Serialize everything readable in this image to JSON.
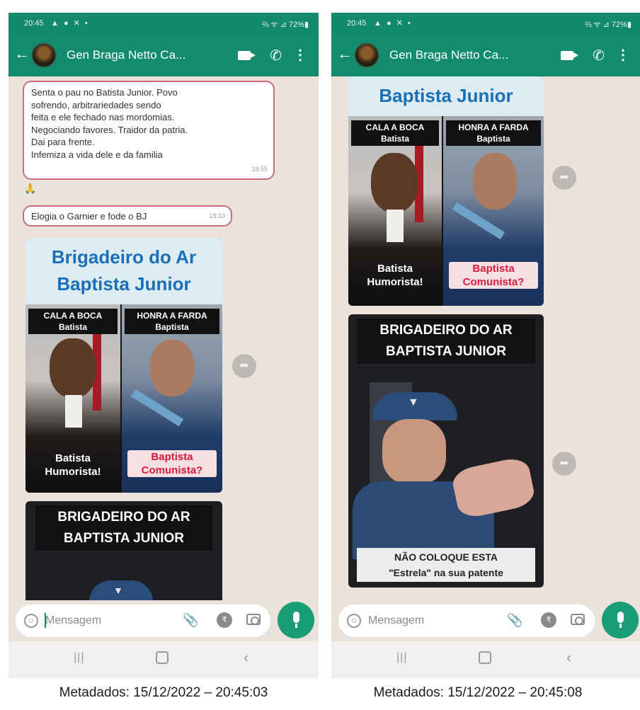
{
  "left": {
    "status": {
      "time": "20:45",
      "notif": "▲ ● ✕ •",
      "sys": "⅔ ᯤ ⊿ 72%▮"
    },
    "contact_name": "Gen Braga Netto Ca...",
    "message1": {
      "lines": [
        "Senta o pau no Batista Junior. Povo",
        "sofrendo, arbitrariedades sendo",
        "feita e ele fechado nas mordomias.",
        "Negociando favores. Traidor da patria.",
        "Dai para frente.",
        "Infemiza a vida dele e da familia"
      ],
      "time": "18:55"
    },
    "reaction": "🙏",
    "message2": {
      "text": "Elogia o Garnier e fode o BJ",
      "time": "19:10"
    },
    "meme1": {
      "header": [
        "Brigadeiro do Ar",
        "Baptista Junior"
      ],
      "tag_left": [
        "CALA A BOCA",
        "Batista"
      ],
      "tag_right": [
        "HONRA A FARDA",
        "Baptista"
      ],
      "caption_left": [
        "Batista",
        "Humorista!"
      ],
      "caption_right": [
        "Baptista",
        "Comunista?"
      ]
    },
    "meme2": {
      "title": [
        "BRIGADEIRO DO AR",
        "BAPTISTA JUNIOR"
      ]
    },
    "composer_placeholder": "Mensagem",
    "metadata": "Metadados: 15/12/2022 – 20:45:03"
  },
  "right": {
    "status": {
      "time": "20:45",
      "notif": "▲ ● ✕ •",
      "sys": "⅔ ᯤ ⊿ 72%▮"
    },
    "contact_name": "Gen Braga Netto Ca...",
    "meme1": {
      "header": [
        "Baptista Junior"
      ],
      "tag_left": [
        "CALA A BOCA",
        "Batista"
      ],
      "tag_right": [
        "HONRA A FARDA",
        "Baptista"
      ],
      "caption_left": [
        "Batista",
        "Humorista!"
      ],
      "caption_right": [
        "Baptista",
        "Comunista?"
      ]
    },
    "meme2": {
      "title": [
        "BRIGADEIRO DO AR",
        "BAPTISTA JUNIOR"
      ],
      "bottom": [
        "NÃO  COLOQUE  ESTA",
        "\"Estrela\" na sua patente"
      ]
    },
    "composer_placeholder": "Mensagem",
    "metadata": "Metadados: 15/12/2022 – 20:45:08"
  },
  "icons": {
    "back": "←",
    "call": "✆",
    "more": "⋮",
    "forward": "➦",
    "attach": "📎",
    "rupee": "₹",
    "emoji": "☺",
    "nav_recent": "|||",
    "nav_back": "‹"
  },
  "colors": {
    "whatsapp_green": "#128c6d",
    "highlight_border": "#c96b7c",
    "chat_bg": "#e9e3db"
  }
}
